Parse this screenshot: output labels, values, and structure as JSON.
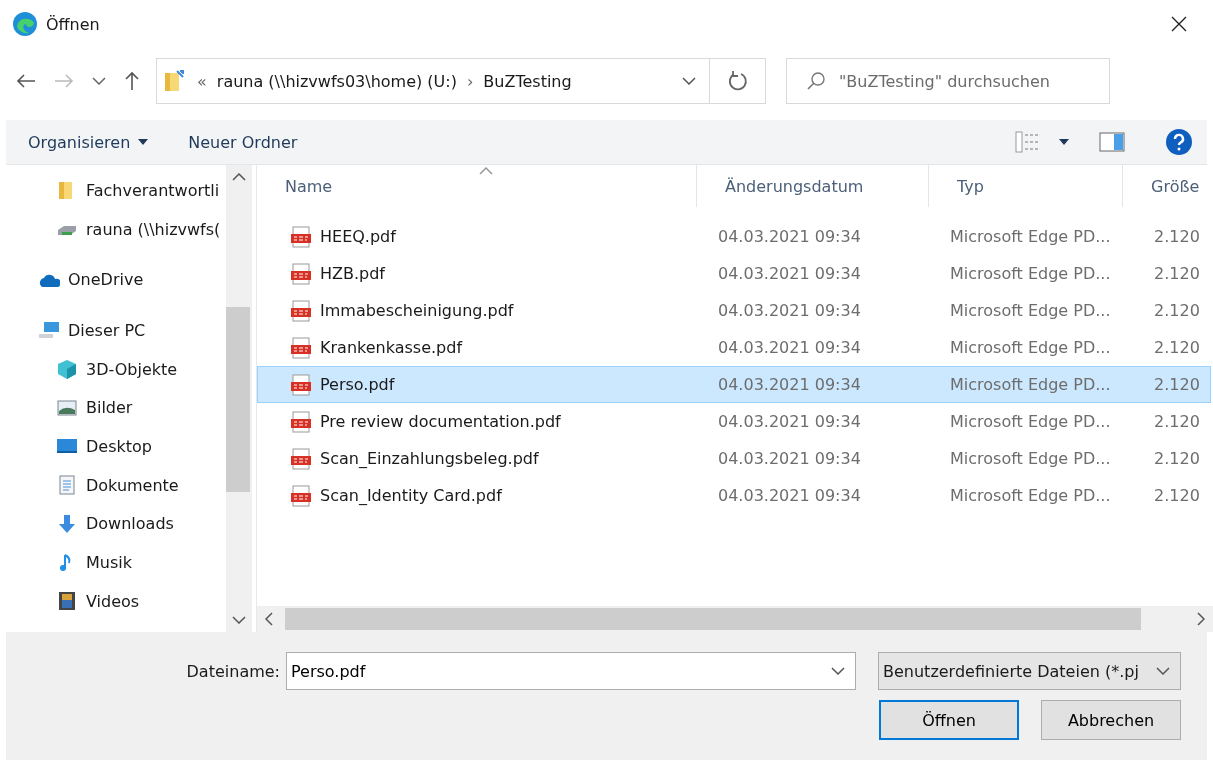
{
  "window": {
    "title": "Öffnen"
  },
  "address": {
    "overflow": "«",
    "segments": [
      "rauna (\\\\hizvwfs03\\home) (U:)",
      "BuZTesting"
    ],
    "separator": "›"
  },
  "search": {
    "placeholder": "\"BuZTesting\" durchsuchen"
  },
  "toolbar": {
    "organize": "Organisieren",
    "new_folder": "Neuer Ordner"
  },
  "sidebar": {
    "items": [
      {
        "label": "Fachverantwortli",
        "kind": "folder",
        "indent": true
      },
      {
        "label": "rauna (\\\\hizvwfs(",
        "kind": "drive",
        "indent": true
      },
      {
        "label": "OneDrive",
        "kind": "cloud",
        "indent": false
      },
      {
        "label": "Dieser PC",
        "kind": "pc",
        "indent": false,
        "children": [
          {
            "label": "3D-Objekte",
            "kind": "cube"
          },
          {
            "label": "Bilder",
            "kind": "pictures"
          },
          {
            "label": "Desktop",
            "kind": "desktop"
          },
          {
            "label": "Dokumente",
            "kind": "documents"
          },
          {
            "label": "Downloads",
            "kind": "downloads"
          },
          {
            "label": "Musik",
            "kind": "music"
          },
          {
            "label": "Videos",
            "kind": "videos"
          }
        ]
      }
    ]
  },
  "table": {
    "columns": [
      "Name",
      "Änderungsdatum",
      "Typ",
      "Größe"
    ],
    "rows": [
      {
        "name": "HEEQ.pdf",
        "date": "04.03.2021 09:34",
        "type": "Microsoft Edge PD...",
        "size": "2.120",
        "selected": false
      },
      {
        "name": "HZB.pdf",
        "date": "04.03.2021 09:34",
        "type": "Microsoft Edge PD...",
        "size": "2.120",
        "selected": false
      },
      {
        "name": "Immabescheinigung.pdf",
        "date": "04.03.2021 09:34",
        "type": "Microsoft Edge PD...",
        "size": "2.120",
        "selected": false
      },
      {
        "name": "Krankenkasse.pdf",
        "date": "04.03.2021 09:34",
        "type": "Microsoft Edge PD...",
        "size": "2.120",
        "selected": false
      },
      {
        "name": "Perso.pdf",
        "date": "04.03.2021 09:34",
        "type": "Microsoft Edge PD...",
        "size": "2.120",
        "selected": true
      },
      {
        "name": "Pre review documentation.pdf",
        "date": "04.03.2021 09:34",
        "type": "Microsoft Edge PD...",
        "size": "2.120",
        "selected": false
      },
      {
        "name": "Scan_Einzahlungsbeleg.pdf",
        "date": "04.03.2021 09:34",
        "type": "Microsoft Edge PD...",
        "size": "2.120",
        "selected": false
      },
      {
        "name": "Scan_Identity Card.pdf",
        "date": "04.03.2021 09:34",
        "type": "Microsoft Edge PD...",
        "size": "2.120",
        "selected": false
      }
    ]
  },
  "footer": {
    "filename_label": "Dateiname:",
    "filename": "Perso.pdf",
    "filter": "Benutzerdefinierte Dateien (*.pj",
    "open": "Öffnen",
    "cancel": "Abbrechen"
  }
}
